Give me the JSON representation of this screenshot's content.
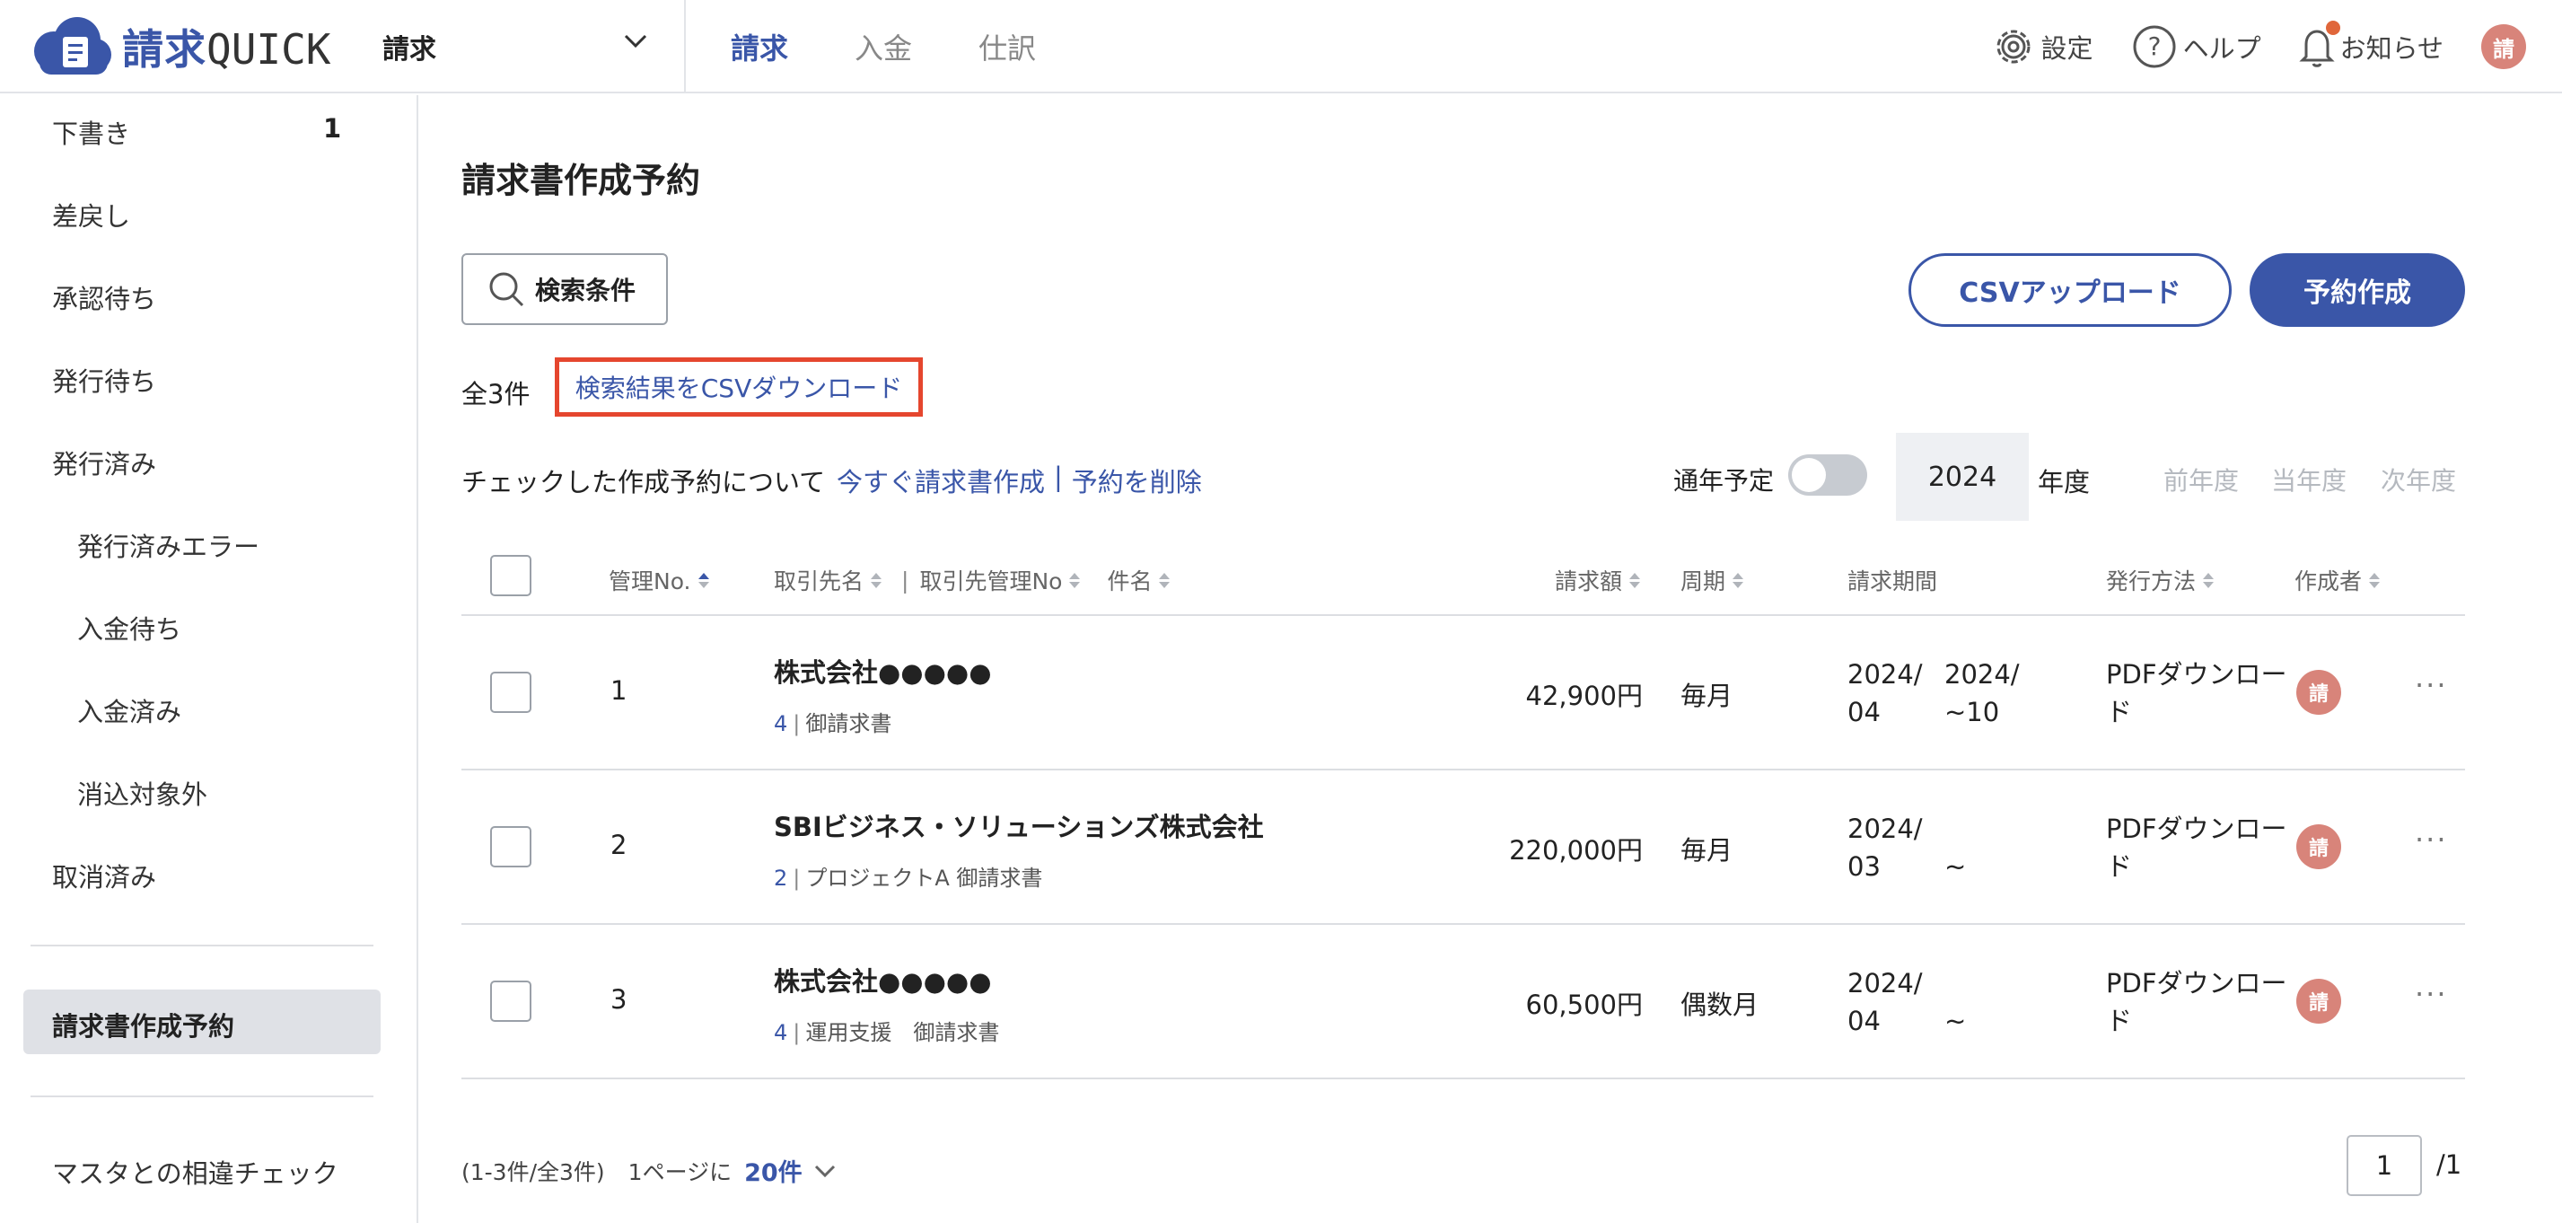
{
  "header": {
    "logo_text_jp": "請求",
    "logo_text_en": "QUICK",
    "service_label": "請求",
    "nav": [
      "請求",
      "入金",
      "仕訳"
    ],
    "settings_label": "設定",
    "help_label": "ヘルプ",
    "notice_label": "お知らせ",
    "avatar": "請"
  },
  "sidebar": {
    "items": [
      {
        "label": "下書き",
        "count": "1"
      },
      {
        "label": "差戻し"
      },
      {
        "label": "承認待ち"
      },
      {
        "label": "発行待ち"
      },
      {
        "label": "発行済み"
      },
      {
        "label": "発行済みエラー"
      },
      {
        "label": "入金待ち"
      },
      {
        "label": "入金済み"
      },
      {
        "label": "消込対象外"
      },
      {
        "label": "取消済み"
      }
    ],
    "active": "請求書作成予約",
    "bottom": "マスタとの相違チェック"
  },
  "main": {
    "title": "請求書作成予約",
    "search_button": "検索条件",
    "csv_upload": "CSVアップロード",
    "create": "予約作成",
    "total": "全3件",
    "csv_download": "検索結果をCSVダウンロード",
    "bulk_label": "チェックした作成予約について",
    "bulk_create": "今すぐ請求書作成",
    "bulk_sep": "|",
    "bulk_delete": "予約を削除",
    "annual_label": "通年予定",
    "year": "2024",
    "year_unit": "年度",
    "prev_year": "前年度",
    "this_year": "当年度",
    "next_year": "次年度"
  },
  "table": {
    "headers": {
      "no": "管理No.",
      "client": "取引先名",
      "sep": "|",
      "client_no": "取引先管理No",
      "subject": "件名",
      "amount": "請求額",
      "cycle": "周期",
      "period": "請求期間",
      "method": "発行方法",
      "creator": "作成者"
    },
    "rows": [
      {
        "no": "1",
        "client": "株式会社●●●●●",
        "client_no": "4",
        "subject": "御請求書",
        "amount": "42,900円",
        "cycle": "毎月",
        "period_start_1": "2024/",
        "period_start_2": "04",
        "period_end_1": "2024/",
        "period_end_2": "~10",
        "method_1": "PDFダウンロー",
        "method_2": "ド",
        "creator": "請"
      },
      {
        "no": "2",
        "client": "SBIビジネス・ソリューションズ株式会社",
        "client_no": "2",
        "subject": "プロジェクトA 御請求書",
        "amount": "220,000円",
        "cycle": "毎月",
        "period_start_1": "2024/",
        "period_start_2": "03",
        "period_end_1": "",
        "period_end_2": "~",
        "method_1": "PDFダウンロー",
        "method_2": "ド",
        "creator": "請"
      },
      {
        "no": "3",
        "client": "株式会社●●●●●",
        "client_no": "4",
        "subject": "運用支援　御請求書",
        "amount": "60,500円",
        "cycle": "偶数月",
        "period_start_1": "2024/",
        "period_start_2": "04",
        "period_end_1": "",
        "period_end_2": "~",
        "method_1": "PDFダウンロー",
        "method_2": "ド",
        "creator": "請"
      }
    ],
    "more_label": "···"
  },
  "pager": {
    "range": "(1-3件/全3件)",
    "per_page_label": "1ページに",
    "per_page_value": "20件",
    "page": "1",
    "total_pages": "/1"
  },
  "colors": {
    "brand": "#3a56a8",
    "highlight": "#e5462e",
    "avatar": "#d8847a",
    "notice_dot": "#e0663a"
  }
}
